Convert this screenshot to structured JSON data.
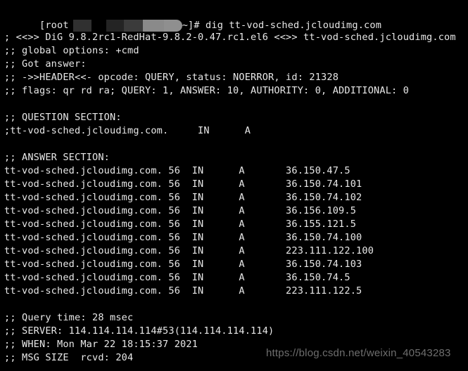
{
  "terminal": {
    "background_color": "#000000",
    "text_color": "#e8e8e8",
    "prompt": {
      "user_host_prefix": "[root",
      "path_suffix": "~]#",
      "command": " dig tt-vod-sched.jcloudimg.com",
      "redacted_blocks": [
        {
          "name": "redaction-block-1",
          "color": "#303030"
        },
        {
          "name": "redaction-block-2",
          "color": "#242424"
        },
        {
          "name": "redaction-block-3",
          "color": "#3b3b3b"
        },
        {
          "name": "redaction-block-4",
          "color": "#8a8a8a"
        },
        {
          "name": "redaction-block-5",
          "color": "#8f8f8f"
        }
      ]
    },
    "output_lines": [
      "",
      "; <<>> DiG 9.8.2rc1-RedHat-9.8.2-0.47.rc1.el6 <<>> tt-vod-sched.jcloudimg.com",
      ";; global options: +cmd",
      ";; Got answer:",
      ";; ->>HEADER<<- opcode: QUERY, status: NOERROR, id: 21328",
      ";; flags: qr rd ra; QUERY: 1, ANSWER: 10, AUTHORITY: 0, ADDITIONAL: 0",
      "",
      ";; QUESTION SECTION:",
      ";tt-vod-sched.jcloudimg.com.     IN      A",
      "",
      ";; ANSWER SECTION:",
      "tt-vod-sched.jcloudimg.com. 56  IN      A       36.150.47.5",
      "tt-vod-sched.jcloudimg.com. 56  IN      A       36.150.74.101",
      "tt-vod-sched.jcloudimg.com. 56  IN      A       36.150.74.102",
      "tt-vod-sched.jcloudimg.com. 56  IN      A       36.156.109.5",
      "tt-vod-sched.jcloudimg.com. 56  IN      A       36.155.121.5",
      "tt-vod-sched.jcloudimg.com. 56  IN      A       36.150.74.100",
      "tt-vod-sched.jcloudimg.com. 56  IN      A       223.111.122.100",
      "tt-vod-sched.jcloudimg.com. 56  IN      A       36.150.74.103",
      "tt-vod-sched.jcloudimg.com. 56  IN      A       36.150.74.5",
      "tt-vod-sched.jcloudimg.com. 56  IN      A       223.111.122.5",
      "",
      ";; Query time: 28 msec",
      ";; SERVER: 114.114.114.114#53(114.114.114.114)",
      ";; WHEN: Mon Mar 22 18:15:37 2021",
      ";; MSG SIZE  rcvd: 204"
    ],
    "dig_details": {
      "version": "9.8.2rc1-RedHat-9.8.2-0.47.rc1.el6",
      "queried_domain": "tt-vod-sched.jcloudimg.com",
      "global_options": "+cmd",
      "opcode": "QUERY",
      "status": "NOERROR",
      "id": "21328",
      "flags": "qr rd ra",
      "counts": {
        "QUERY": "1",
        "ANSWER": "10",
        "AUTHORITY": "0",
        "ADDITIONAL": "0"
      },
      "question": {
        "name": "tt-vod-sched.jcloudimg.com.",
        "class": "IN",
        "type": "A"
      },
      "answers": [
        {
          "name": "tt-vod-sched.jcloudimg.com.",
          "ttl": "56",
          "class": "IN",
          "type": "A",
          "address": "36.150.47.5"
        },
        {
          "name": "tt-vod-sched.jcloudimg.com.",
          "ttl": "56",
          "class": "IN",
          "type": "A",
          "address": "36.150.74.101"
        },
        {
          "name": "tt-vod-sched.jcloudimg.com.",
          "ttl": "56",
          "class": "IN",
          "type": "A",
          "address": "36.150.74.102"
        },
        {
          "name": "tt-vod-sched.jcloudimg.com.",
          "ttl": "56",
          "class": "IN",
          "type": "A",
          "address": "36.156.109.5"
        },
        {
          "name": "tt-vod-sched.jcloudimg.com.",
          "ttl": "56",
          "class": "IN",
          "type": "A",
          "address": "36.155.121.5"
        },
        {
          "name": "tt-vod-sched.jcloudimg.com.",
          "ttl": "56",
          "class": "IN",
          "type": "A",
          "address": "36.150.74.100"
        },
        {
          "name": "tt-vod-sched.jcloudimg.com.",
          "ttl": "56",
          "class": "IN",
          "type": "A",
          "address": "223.111.122.100"
        },
        {
          "name": "tt-vod-sched.jcloudimg.com.",
          "ttl": "56",
          "class": "IN",
          "type": "A",
          "address": "36.150.74.103"
        },
        {
          "name": "tt-vod-sched.jcloudimg.com.",
          "ttl": "56",
          "class": "IN",
          "type": "A",
          "address": "36.150.74.5"
        },
        {
          "name": "tt-vod-sched.jcloudimg.com.",
          "ttl": "56",
          "class": "IN",
          "type": "A",
          "address": "223.111.122.5"
        }
      ],
      "query_time": "28 msec",
      "server": "114.114.114.114#53(114.114.114.114)",
      "when": "Mon Mar 22 18:15:37 2021",
      "msg_size_rcvd": "204"
    }
  },
  "watermark": {
    "text": "https://blog.csdn.net/weixin_40543283",
    "color": "#6e6e6e"
  }
}
